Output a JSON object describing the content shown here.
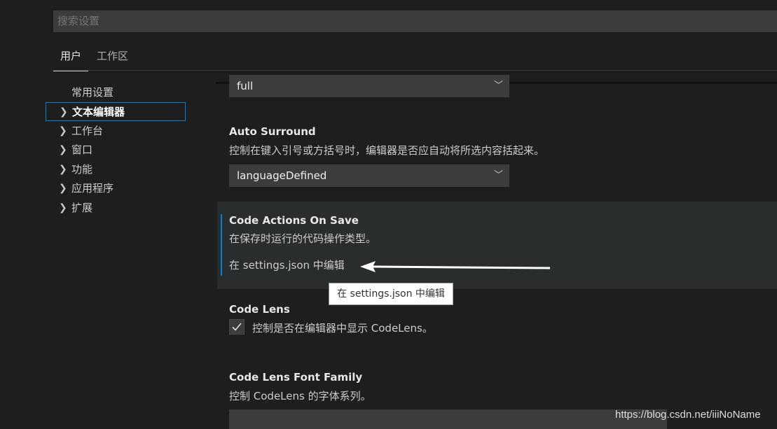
{
  "search": {
    "placeholder": "搜索设置"
  },
  "tabs": [
    {
      "label": "用户",
      "active": true
    },
    {
      "label": "工作区",
      "active": false
    }
  ],
  "toc": [
    {
      "label": "常用设置",
      "expandable": false
    },
    {
      "label": "文本编辑器",
      "expandable": true,
      "selected": true
    },
    {
      "label": "工作台",
      "expandable": true
    },
    {
      "label": "窗口",
      "expandable": true
    },
    {
      "label": "功能",
      "expandable": true
    },
    {
      "label": "应用程序",
      "expandable": true
    },
    {
      "label": "扩展",
      "expandable": true
    }
  ],
  "settings": {
    "prev_select": {
      "value": "full"
    },
    "auto_surround": {
      "title": "Auto Surround",
      "description": "控制在键入引号或方括号时，编辑器是否应自动将所选内容括起来。",
      "value": "languageDefined"
    },
    "code_actions": {
      "title": "Code Actions On Save",
      "description": "在保存时运行的代码操作类型。",
      "edit_link": "在 settings.json 中编辑",
      "tooltip": "在 settings.json 中编辑"
    },
    "code_lens": {
      "title": "Code Lens",
      "description": "控制是否在编辑器中显示 CodeLens。",
      "checked": true
    },
    "code_lens_font": {
      "title": "Code Lens Font Family",
      "description": "控制 CodeLens 的字体系列。"
    }
  },
  "icons": {
    "chevron": "chevron-right-icon",
    "dropdown": "chevron-down-icon",
    "check": "check-icon"
  },
  "colors": {
    "background": "#1e1e1e",
    "accent": "#007fd4",
    "input_bg": "#3c3c3c"
  },
  "watermark": "https://blog.csdn.net/iiiNoName"
}
